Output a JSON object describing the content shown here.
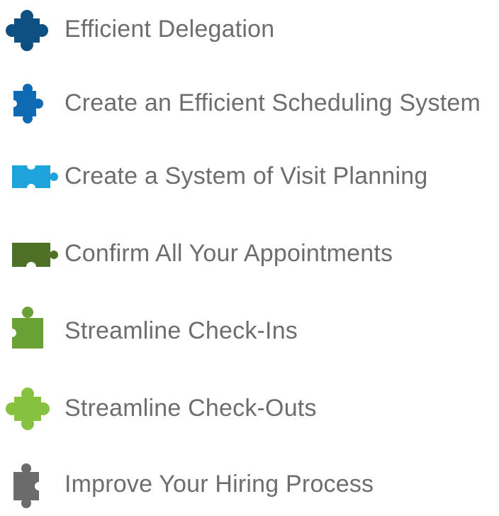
{
  "items": [
    {
      "label": "Efficient Delegation",
      "icon": "puzzle-piece-icon",
      "color": "#0d4f80"
    },
    {
      "label": "Create an Efficient Scheduling System",
      "icon": "puzzle-piece-icon",
      "color": "#0f6ab4"
    },
    {
      "label": "Create a System of Visit Planning",
      "icon": "puzzle-piece-icon",
      "color": "#1ea4dd"
    },
    {
      "label": "Confirm All Your Appointments",
      "icon": "puzzle-piece-icon",
      "color": "#4e7126"
    },
    {
      "label": "Streamline Check-Ins",
      "icon": "puzzle-piece-icon",
      "color": "#6aa135"
    },
    {
      "label": "Streamline Check-Outs",
      "icon": "puzzle-piece-icon",
      "color": "#86c23f"
    },
    {
      "label": "Improve Your Hiring Process",
      "icon": "puzzle-piece-icon",
      "color": "#6b6b6b"
    }
  ]
}
